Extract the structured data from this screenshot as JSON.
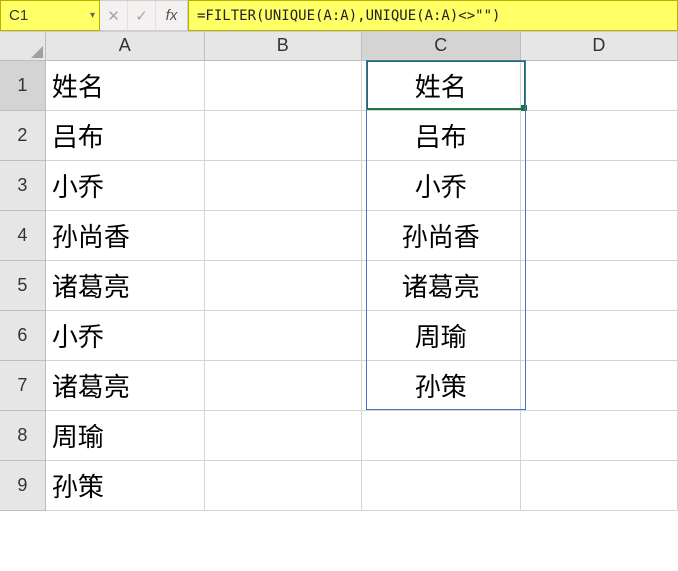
{
  "namebox": {
    "value": "C1"
  },
  "fx": {
    "cancel": "✕",
    "confirm": "✓",
    "label": "fx"
  },
  "formula": {
    "text": "=FILTER(UNIQUE(A:A),UNIQUE(A:A)<>\"\")"
  },
  "columns": [
    "A",
    "B",
    "C",
    "D"
  ],
  "rows": [
    "1",
    "2",
    "3",
    "4",
    "5",
    "6",
    "7",
    "8",
    "9"
  ],
  "cells": {
    "A1": "姓名",
    "A2": "吕布",
    "A3": "小乔",
    "A4": "孙尚香",
    "A5": "诸葛亮",
    "A6": "小乔",
    "A7": "诸葛亮",
    "A8": "周瑜",
    "A9": "孙策",
    "C1": "姓名",
    "C2": "吕布",
    "C3": "小乔",
    "C4": "孙尚香",
    "C5": "诸葛亮",
    "C6": "周瑜",
    "C7": "孙策"
  },
  "active": {
    "row": 1,
    "col": "C"
  },
  "spill": {
    "col": "C",
    "from": 1,
    "to": 7
  },
  "chart_data": {
    "type": "table",
    "title": "Unique non-empty names from column A",
    "columns": [
      "姓名"
    ],
    "source": [
      "姓名",
      "吕布",
      "小乔",
      "孙尚香",
      "诸葛亮",
      "小乔",
      "诸葛亮",
      "周瑜",
      "孙策"
    ],
    "result": [
      "姓名",
      "吕布",
      "小乔",
      "孙尚香",
      "诸葛亮",
      "周瑜",
      "孙策"
    ]
  }
}
